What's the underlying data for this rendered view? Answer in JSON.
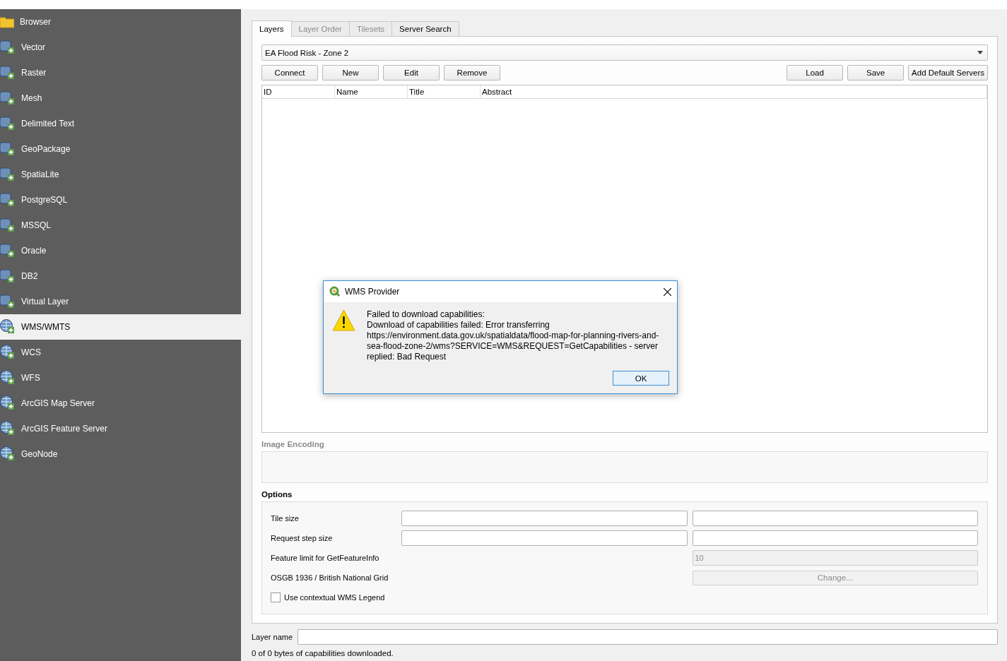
{
  "sidebar": {
    "items": [
      {
        "label": "Browser",
        "selected": false
      },
      {
        "label": "Vector",
        "selected": false
      },
      {
        "label": "Raster",
        "selected": false
      },
      {
        "label": "Mesh",
        "selected": false
      },
      {
        "label": "Delimited Text",
        "selected": false
      },
      {
        "label": "GeoPackage",
        "selected": false
      },
      {
        "label": "SpatiaLite",
        "selected": false
      },
      {
        "label": "PostgreSQL",
        "selected": false
      },
      {
        "label": "MSSQL",
        "selected": false
      },
      {
        "label": "Oracle",
        "selected": false
      },
      {
        "label": "DB2",
        "selected": false
      },
      {
        "label": "Virtual Layer",
        "selected": false
      },
      {
        "label": "WMS/WMTS",
        "selected": true
      },
      {
        "label": "WCS",
        "selected": false
      },
      {
        "label": "WFS",
        "selected": false
      },
      {
        "label": "ArcGIS Map Server",
        "selected": false
      },
      {
        "label": "ArcGIS Feature Server",
        "selected": false
      },
      {
        "label": "GeoNode",
        "selected": false
      }
    ]
  },
  "tabs": [
    {
      "label": "Layers",
      "selected": true,
      "disabled": false
    },
    {
      "label": "Layer Order",
      "selected": false,
      "disabled": true
    },
    {
      "label": "Tilesets",
      "selected": false,
      "disabled": true
    },
    {
      "label": "Server Search",
      "selected": false,
      "disabled": false
    }
  ],
  "connection": {
    "value": "EA Flood Risk - Zone 2"
  },
  "connection_buttons": [
    "Connect",
    "New",
    "Edit",
    "Remove"
  ],
  "file_buttons": [
    "Load",
    "Save",
    "Add Default Servers"
  ],
  "table": {
    "columns": [
      "ID",
      "Name",
      "Title",
      "Abstract"
    ]
  },
  "image_encoding": {
    "title": "Image Encoding",
    "disabled": true
  },
  "options": {
    "title": "Options",
    "rows": [
      {
        "kind": "pair",
        "label": "Tile size"
      },
      {
        "kind": "pair",
        "label": "Request step size"
      },
      {
        "kind": "limit",
        "label": "Feature limit for GetFeatureInfo",
        "value": "10",
        "disabled": true
      },
      {
        "kind": "crs",
        "label": "OSGB 1936 / British National Grid",
        "button": "Change...",
        "disabled": true
      },
      {
        "kind": "checkbox",
        "label": "Use contextual WMS Legend",
        "checked": false
      }
    ]
  },
  "layer_name": {
    "label": "Layer name"
  },
  "status": "0 of 0 bytes of capabilities downloaded.",
  "dialog": {
    "title": "WMS Provider",
    "heading": "Failed to download capabilities:",
    "message": "Download of capabilities failed: Error transferring https://environment.data.gov.uk/spatialdata/flood-map-for-planning-rivers-and-sea-flood-zone-2/wms?SERVICE=WMS&REQUEST=GetCapabilities - server replied: Bad Request",
    "button": "OK"
  }
}
